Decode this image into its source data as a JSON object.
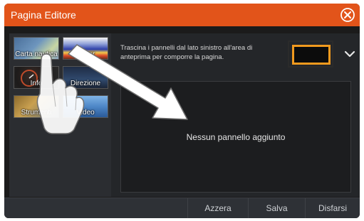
{
  "window": {
    "title": "Pagina Editore"
  },
  "instructions": "Trascina i pannelli dal lato sinistro all'area di anteprima per comporre la pagina.",
  "preview": {
    "empty_message": "Nessun pannello aggiunto"
  },
  "panels": [
    {
      "label": "Carta nautica",
      "icon": "chart-thumbnail"
    },
    {
      "label": "Sonar",
      "icon": "sonar-thumbnail"
    },
    {
      "label": "Info",
      "icon": "info-thumbnail"
    },
    {
      "label": "Direzione",
      "icon": "steering-thumbnail"
    },
    {
      "label": "Strumenti",
      "icon": "instruments-thumbnail"
    },
    {
      "label": "Video",
      "icon": "video-thumbnail"
    }
  ],
  "buttons": {
    "reset": "Azzera",
    "save": "Salva",
    "discard": "Disfarsi"
  },
  "colors": {
    "titlebar": "#e2541a",
    "layout_accent": "#f29a1e",
    "panel_bg": "#242629"
  }
}
